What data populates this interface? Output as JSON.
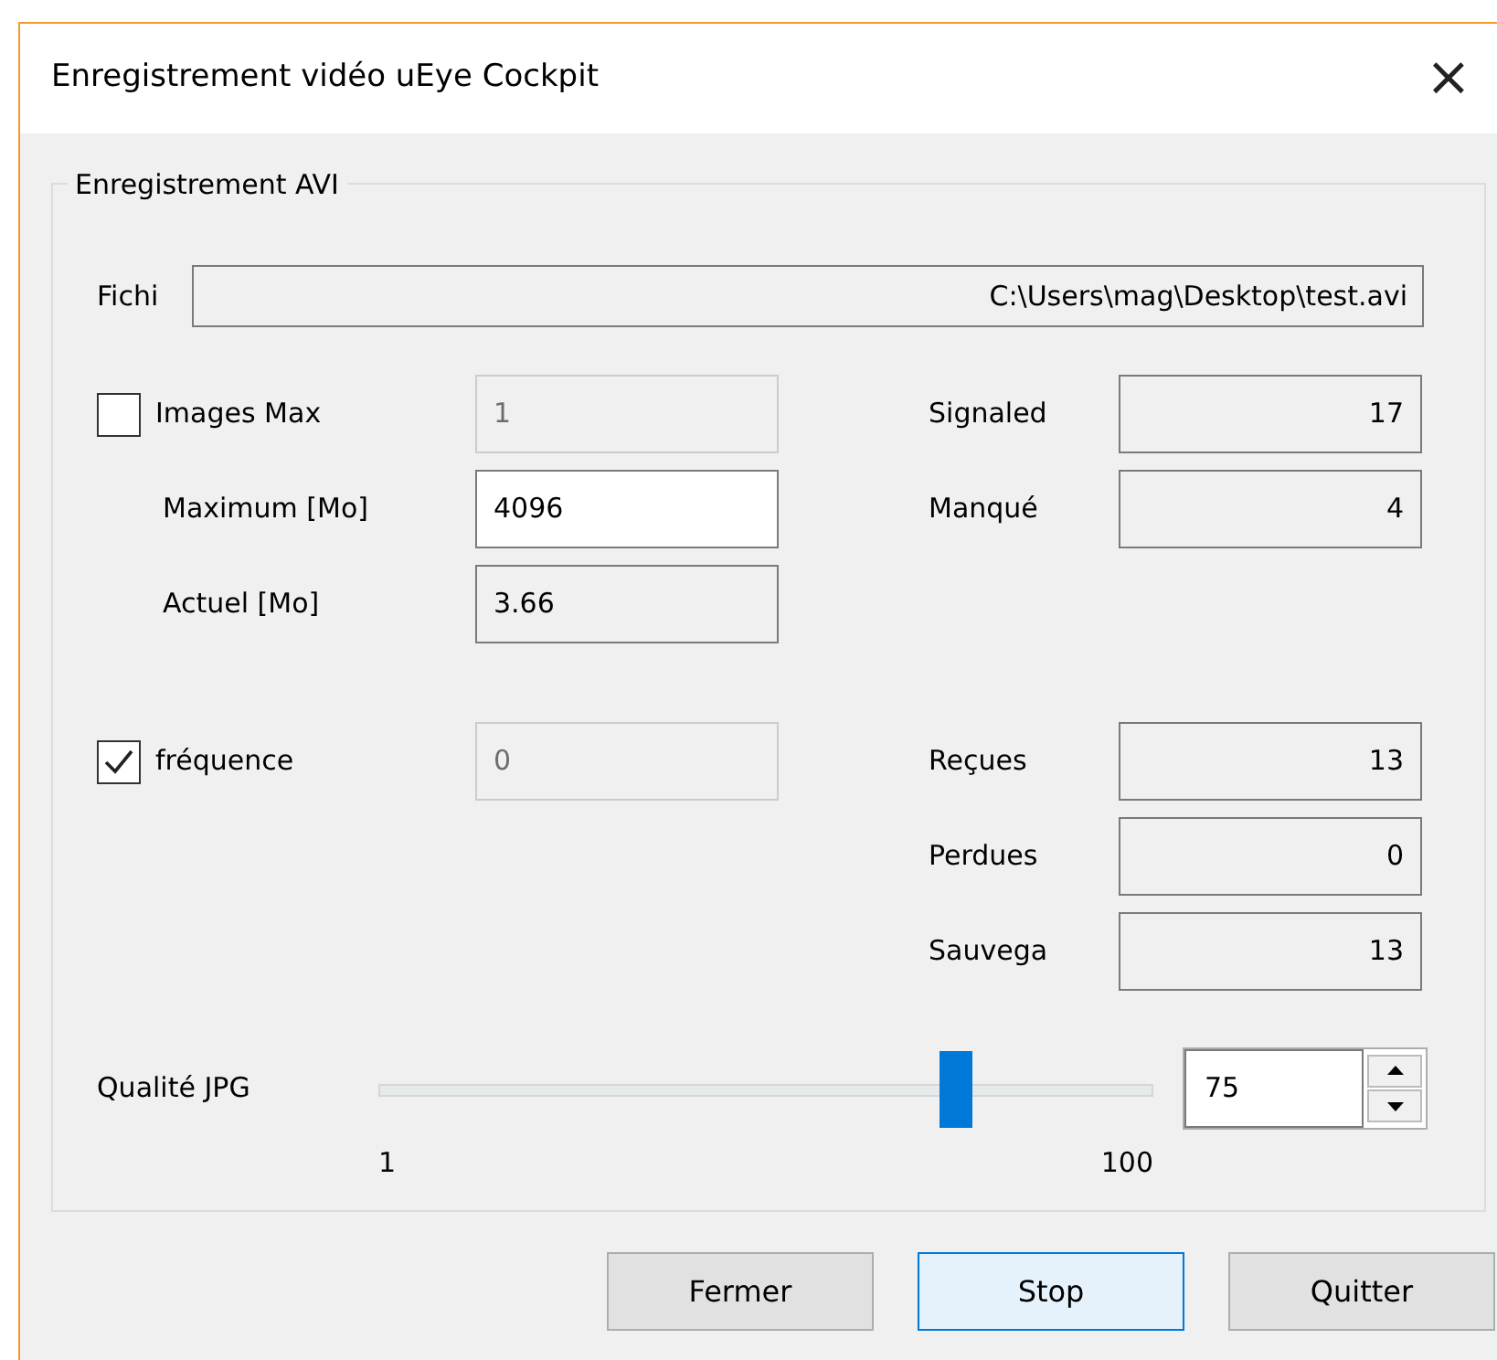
{
  "window": {
    "title": "Enregistrement vidéo uEye Cockpit",
    "close": "×"
  },
  "group": {
    "title": "Enregistrement AVI"
  },
  "file": {
    "label": "Fichi",
    "value": "C:\\Users\\mag\\Desktop\\test.avi"
  },
  "left_rows": [
    {
      "kind": "check",
      "label": "Images Max",
      "checked": false,
      "value": "1",
      "disabled": true
    },
    {
      "kind": "field",
      "label": "Maximum [Mo]",
      "value": "4096",
      "disabled": false
    },
    {
      "kind": "field",
      "label": "Actuel [Mo]",
      "value": "3.66",
      "readonly": true
    },
    {
      "kind": "gap"
    },
    {
      "kind": "check",
      "label": "fréquence",
      "checked": true,
      "value": "0",
      "disabled": true
    }
  ],
  "right_rows": [
    {
      "kind": "stat",
      "label": "Signaled",
      "value": "17"
    },
    {
      "kind": "stat",
      "label": "Manqué",
      "value": "4"
    },
    {
      "kind": "gap"
    },
    {
      "kind": "gap"
    },
    {
      "kind": "stat",
      "label": "Reçues",
      "value": "13"
    },
    {
      "kind": "stat",
      "label": "Perdues",
      "value": "0"
    },
    {
      "kind": "stat",
      "label": "Sauvega",
      "value": "13"
    }
  ],
  "quality": {
    "label": "Qualité JPG",
    "level": 0.747,
    "min_label": "1",
    "max_label": "100",
    "value": "75"
  },
  "buttons": [
    {
      "label": "Fermer",
      "selected": false
    },
    {
      "label": "Stop",
      "selected": true
    },
    {
      "label": "Quitter",
      "selected": false
    }
  ]
}
